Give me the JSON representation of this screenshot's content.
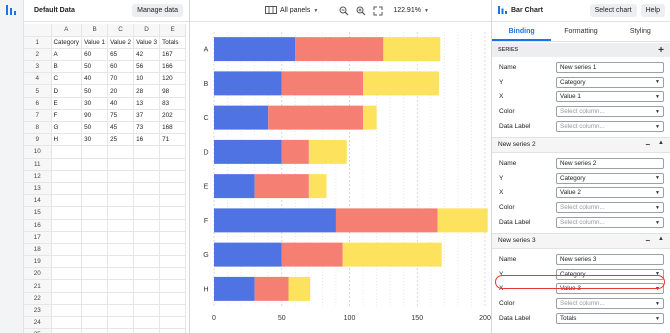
{
  "data_panel": {
    "title": "Default Data",
    "manage_button": "Manage data",
    "columns": [
      "A",
      "B",
      "C",
      "D",
      "E"
    ],
    "rows": [
      [
        "1",
        "Category",
        "Value 1",
        "Value 2",
        "Value 3",
        "Totals"
      ],
      [
        "2",
        "A",
        "60",
        "65",
        "42",
        "167"
      ],
      [
        "3",
        "B",
        "50",
        "60",
        "56",
        "166"
      ],
      [
        "4",
        "C",
        "40",
        "70",
        "10",
        "120"
      ],
      [
        "5",
        "D",
        "50",
        "20",
        "28",
        "98"
      ],
      [
        "6",
        "E",
        "30",
        "40",
        "13",
        "83"
      ],
      [
        "7",
        "F",
        "90",
        "75",
        "37",
        "202"
      ],
      [
        "8",
        "G",
        "50",
        "45",
        "73",
        "168"
      ],
      [
        "9",
        "H",
        "30",
        "25",
        "16",
        "71"
      ],
      [
        "10",
        "",
        "",
        "",
        "",
        ""
      ],
      [
        "11",
        "",
        "",
        "",
        "",
        ""
      ],
      [
        "12",
        "",
        "",
        "",
        "",
        ""
      ],
      [
        "13",
        "",
        "",
        "",
        "",
        ""
      ],
      [
        "14",
        "",
        "",
        "",
        "",
        ""
      ],
      [
        "15",
        "",
        "",
        "",
        "",
        ""
      ],
      [
        "16",
        "",
        "",
        "",
        "",
        ""
      ],
      [
        "17",
        "",
        "",
        "",
        "",
        ""
      ],
      [
        "18",
        "",
        "",
        "",
        "",
        ""
      ],
      [
        "19",
        "",
        "",
        "",
        "",
        ""
      ],
      [
        "20",
        "",
        "",
        "",
        "",
        ""
      ],
      [
        "21",
        "",
        "",
        "",
        "",
        ""
      ],
      [
        "22",
        "",
        "",
        "",
        "",
        ""
      ],
      [
        "23",
        "",
        "",
        "",
        "",
        ""
      ],
      [
        "24",
        "",
        "",
        "",
        "",
        ""
      ],
      [
        "25",
        "",
        "",
        "",
        "",
        ""
      ]
    ]
  },
  "toolbar": {
    "panels_label": "All panels",
    "zoom_label": "122.91%"
  },
  "chart_data": {
    "type": "bar",
    "orientation": "horizontal",
    "stacked": true,
    "categories": [
      "A",
      "B",
      "C",
      "D",
      "E",
      "F",
      "G",
      "H"
    ],
    "series": [
      {
        "values": [
          60,
          50,
          40,
          50,
          30,
          90,
          50,
          30
        ],
        "color": "#4f73e3"
      },
      {
        "values": [
          65,
          60,
          70,
          20,
          40,
          75,
          45,
          25
        ],
        "color": "#f47f72"
      },
      {
        "values": [
          42,
          56,
          10,
          28,
          13,
          37,
          73,
          16
        ],
        "color": "#fde35d"
      }
    ],
    "xlim": [
      0,
      200
    ],
    "x_ticks": [
      "0",
      "50",
      "100",
      "150",
      "200"
    ],
    "grid": true
  },
  "settings": {
    "title": "Bar Chart",
    "select_chart_button": "Select chart",
    "help_button": "Help",
    "tabs": [
      "Binding",
      "Formatting",
      "Styling"
    ],
    "series_section": "SERIES",
    "series": [
      {
        "header": "",
        "name_label": "Name",
        "name": "New series 1",
        "y_label": "Y",
        "y": "Category",
        "x_label": "X",
        "x": "Value 1",
        "color_label": "Color",
        "color": "Select column...",
        "data_label_label": "Data Label",
        "data_label": "Select column..."
      },
      {
        "header": "New series 2",
        "name_label": "Name",
        "name": "New series 2",
        "y_label": "Y",
        "y": "Category",
        "x_label": "X",
        "x": "Value 2",
        "color_label": "Color",
        "color": "Select column...",
        "data_label_label": "Data Label",
        "data_label": "Select column..."
      },
      {
        "header": "New series 3",
        "name_label": "Name",
        "name": "New series 3",
        "y_label": "Y",
        "y": "Category",
        "x_label": "X",
        "x": "Value 3",
        "color_label": "Color",
        "color": "Select column...",
        "data_label_label": "Data Label",
        "data_label": "Totals"
      }
    ]
  }
}
